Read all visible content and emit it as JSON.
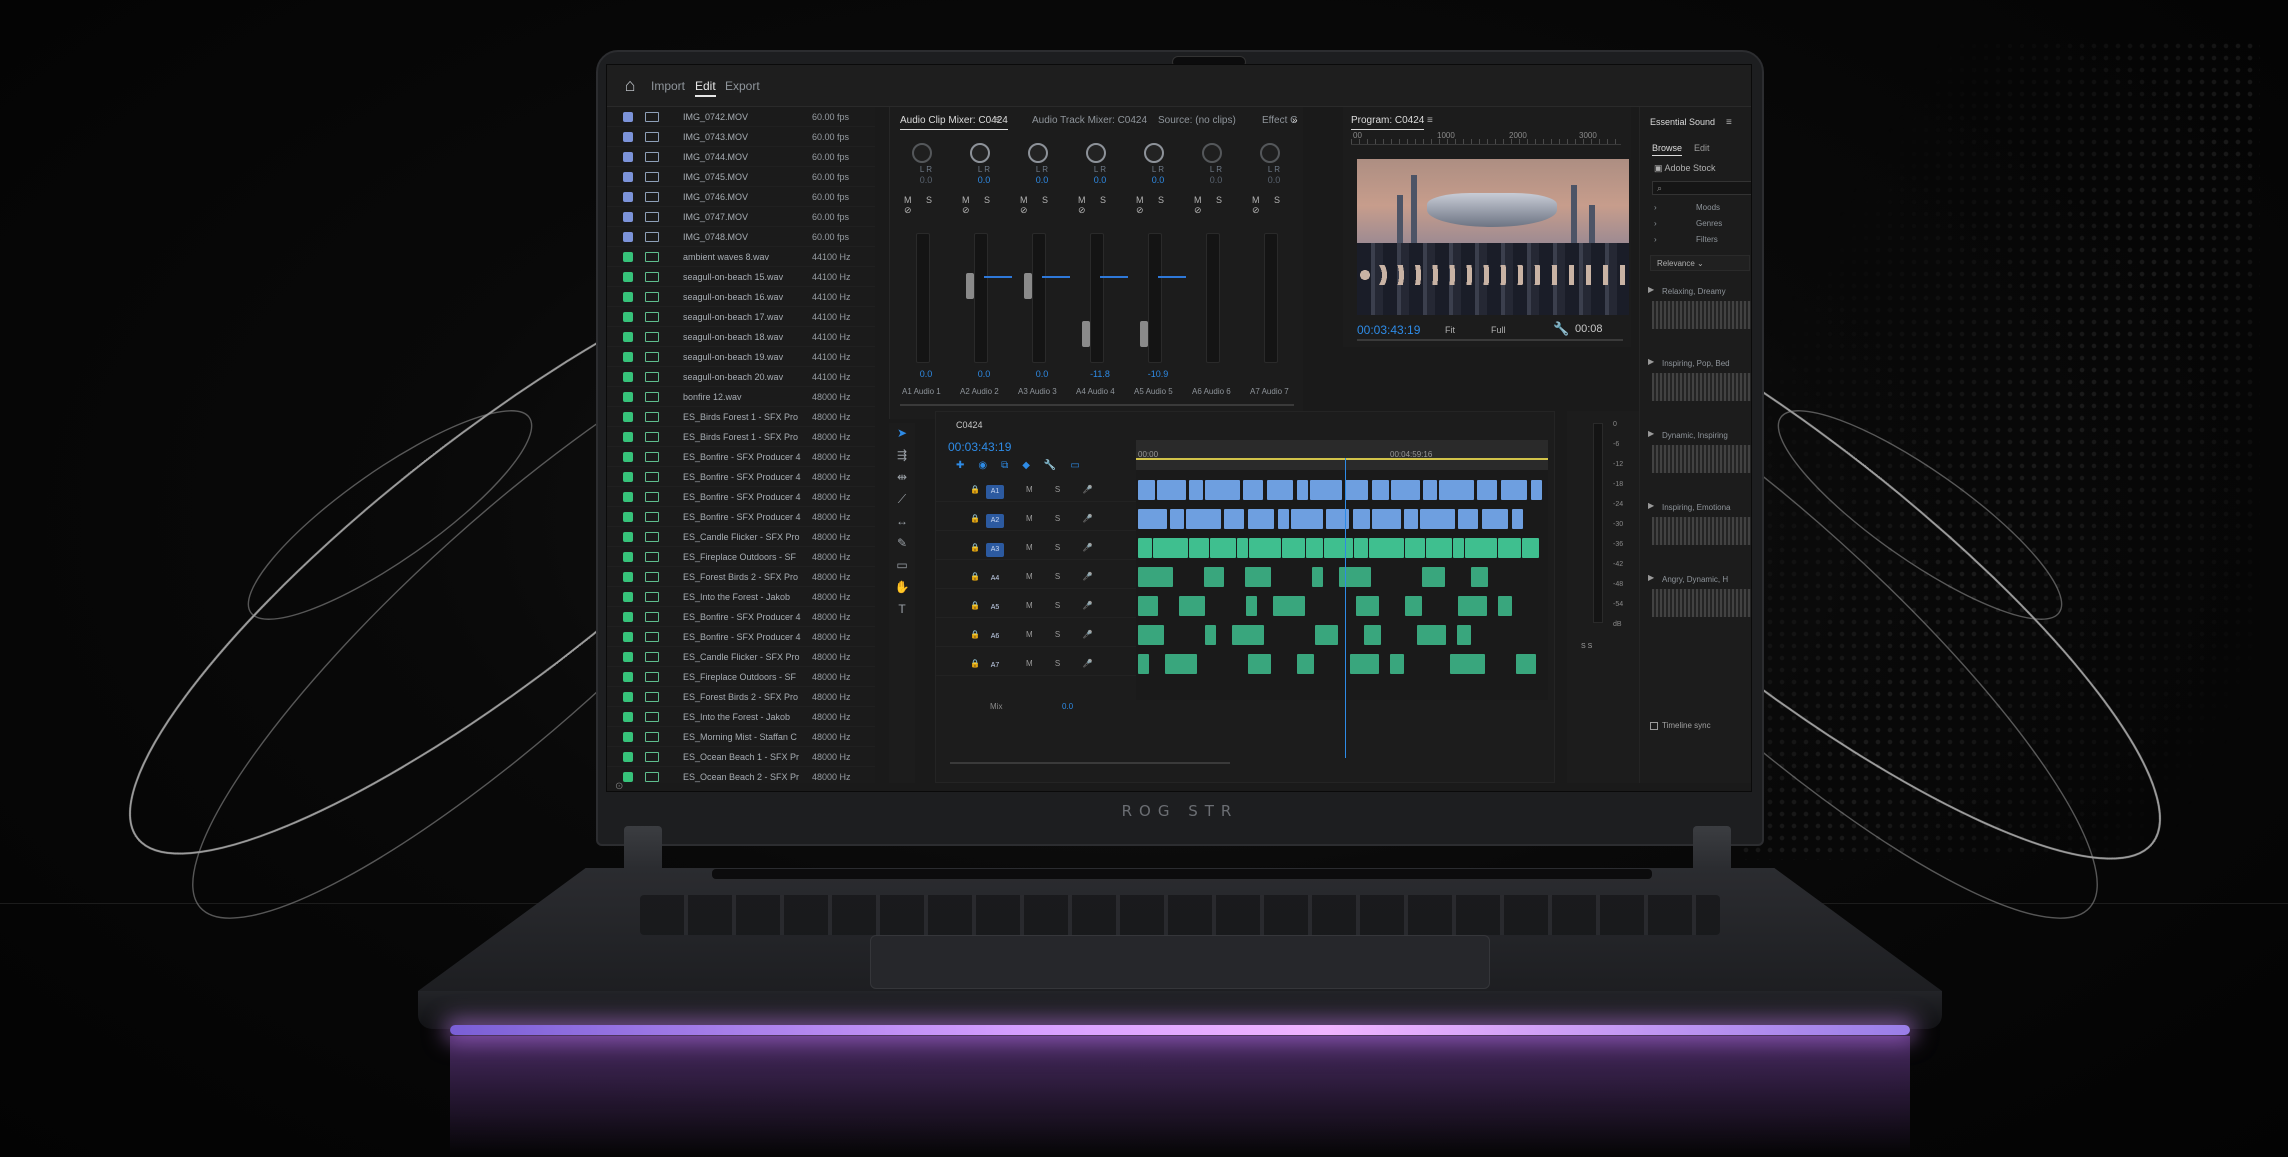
{
  "brand": {
    "text": "ROG STR"
  },
  "topbar": {
    "import": "Import",
    "edit": "Edit",
    "export": "Export"
  },
  "project_items": [
    {
      "name": "IMG_0742.MOV",
      "rate": "60.00 fps",
      "kind": "video"
    },
    {
      "name": "IMG_0743.MOV",
      "rate": "60.00 fps",
      "kind": "video"
    },
    {
      "name": "IMG_0744.MOV",
      "rate": "60.00 fps",
      "kind": "video"
    },
    {
      "name": "IMG_0745.MOV",
      "rate": "60.00 fps",
      "kind": "video"
    },
    {
      "name": "IMG_0746.MOV",
      "rate": "60.00 fps",
      "kind": "video"
    },
    {
      "name": "IMG_0747.MOV",
      "rate": "60.00 fps",
      "kind": "video"
    },
    {
      "name": "IMG_0748.MOV",
      "rate": "60.00 fps",
      "kind": "video"
    },
    {
      "name": "ambient waves 8.wav",
      "rate": "44100 Hz",
      "kind": "audio"
    },
    {
      "name": "seagull-on-beach 15.wav",
      "rate": "44100 Hz",
      "kind": "audio"
    },
    {
      "name": "seagull-on-beach 16.wav",
      "rate": "44100 Hz",
      "kind": "audio"
    },
    {
      "name": "seagull-on-beach 17.wav",
      "rate": "44100 Hz",
      "kind": "audio"
    },
    {
      "name": "seagull-on-beach 18.wav",
      "rate": "44100 Hz",
      "kind": "audio"
    },
    {
      "name": "seagull-on-beach 19.wav",
      "rate": "44100 Hz",
      "kind": "audio"
    },
    {
      "name": "seagull-on-beach 20.wav",
      "rate": "44100 Hz",
      "kind": "audio"
    },
    {
      "name": "bonfire 12.wav",
      "rate": "48000 Hz",
      "kind": "audio"
    },
    {
      "name": "ES_Birds Forest 1 - SFX Pro",
      "rate": "48000 Hz",
      "kind": "audio"
    },
    {
      "name": "ES_Birds Forest 1 - SFX Pro",
      "rate": "48000 Hz",
      "kind": "audio"
    },
    {
      "name": "ES_Bonfire - SFX Producer 4",
      "rate": "48000 Hz",
      "kind": "audio"
    },
    {
      "name": "ES_Bonfire - SFX Producer 4",
      "rate": "48000 Hz",
      "kind": "audio"
    },
    {
      "name": "ES_Bonfire - SFX Producer 4",
      "rate": "48000 Hz",
      "kind": "audio"
    },
    {
      "name": "ES_Bonfire - SFX Producer 4",
      "rate": "48000 Hz",
      "kind": "audio"
    },
    {
      "name": "ES_Candle Flicker - SFX Pro",
      "rate": "48000 Hz",
      "kind": "audio"
    },
    {
      "name": "ES_Fireplace Outdoors - SF",
      "rate": "48000 Hz",
      "kind": "audio"
    },
    {
      "name": "ES_Forest Birds 2 - SFX Pro",
      "rate": "48000 Hz",
      "kind": "audio"
    },
    {
      "name": "ES_Into the Forest - Jakob",
      "rate": "48000 Hz",
      "kind": "audio"
    },
    {
      "name": "ES_Bonfire - SFX Producer 4",
      "rate": "48000 Hz",
      "kind": "audio"
    },
    {
      "name": "ES_Bonfire - SFX Producer 4",
      "rate": "48000 Hz",
      "kind": "audio"
    },
    {
      "name": "ES_Candle Flicker - SFX Pro",
      "rate": "48000 Hz",
      "kind": "audio"
    },
    {
      "name": "ES_Fireplace Outdoors - SF",
      "rate": "48000 Hz",
      "kind": "audio"
    },
    {
      "name": "ES_Forest Birds 2 - SFX Pro",
      "rate": "48000 Hz",
      "kind": "audio"
    },
    {
      "name": "ES_Into the Forest - Jakob",
      "rate": "48000 Hz",
      "kind": "audio"
    },
    {
      "name": "ES_Morning Mist - Staffan C",
      "rate": "48000 Hz",
      "kind": "audio"
    },
    {
      "name": "ES_Ocean Beach 1 - SFX Pr",
      "rate": "48000 Hz",
      "kind": "audio"
    },
    {
      "name": "ES_Ocean Beach 2 - SFX Pr",
      "rate": "48000 Hz",
      "kind": "audio"
    }
  ],
  "mixer": {
    "tabs": [
      "Audio Clip Mixer: C0424",
      "Audio Track Mixer: C0424",
      "Source: (no clips)",
      "Effect C"
    ],
    "strip_lr": "L R",
    "strip_ms": "M S ⊘",
    "channels": [
      {
        "knob": "0.0",
        "fader": "0.0",
        "label": "A1",
        "name": "Audio 1",
        "active": false
      },
      {
        "knob": "0.0",
        "fader": "0.0",
        "label": "A2",
        "name": "Audio 2",
        "active": true
      },
      {
        "knob": "0.0",
        "fader": "0.0",
        "label": "A3",
        "name": "Audio 3",
        "active": true
      },
      {
        "knob": "0.0",
        "fader": "-11.8",
        "label": "A4",
        "name": "Audio 4",
        "active": true
      },
      {
        "knob": "0.0",
        "fader": "-10.9",
        "label": "A5",
        "name": "Audio 5",
        "active": true
      },
      {
        "knob": "0.0",
        "fader": "",
        "label": "A6",
        "name": "Audio 6",
        "active": false
      },
      {
        "knob": "0.0",
        "fader": "",
        "label": "A7",
        "name": "Audio 7",
        "active": false
      }
    ]
  },
  "program": {
    "title": "Program: C0424",
    "ruler": [
      "00",
      "1000",
      "2000",
      "3000"
    ],
    "timecode": "00:03:43:19",
    "fit": "Fit",
    "full": "Full",
    "duration": "00:08"
  },
  "timeline": {
    "tab": "C0424",
    "timecode": "00:03:43:19",
    "ruler": [
      "00:00",
      "00:04:59:16"
    ],
    "tracks": [
      {
        "name": "A1",
        "selected": true
      },
      {
        "name": "A2",
        "selected": true
      },
      {
        "name": "A3",
        "selected": true
      },
      {
        "name": "A4",
        "selected": false
      },
      {
        "name": "A5",
        "selected": false
      },
      {
        "name": "A6",
        "selected": false
      },
      {
        "name": "A7",
        "selected": false
      }
    ],
    "track_ms": "M S 🎤",
    "mix_label": "Mix",
    "mix_value": "0.0",
    "meter_scale": [
      "0",
      "-6",
      "-12",
      "-18",
      "-24",
      "-30",
      "-36",
      "-42",
      "-48",
      "-54",
      "dB"
    ],
    "meter_solo": "S S"
  },
  "essential_sound": {
    "title": "Essential Sound",
    "tabs": [
      "Browse",
      "Edit"
    ],
    "stock": "Adobe Stock",
    "filters": [
      "Moods",
      "Genres",
      "Filters"
    ],
    "sort": "Relevance",
    "results": [
      "Relaxing, Dreamy",
      "Inspiring, Pop, Bed",
      "Dynamic, Inspiring",
      "Inspiring, Emotiona",
      "Angry, Dynamic, H"
    ],
    "sync": "Timeline sync"
  },
  "colors": {
    "accent": "#2e8be6",
    "video_label": "#7c93d9",
    "audio_label": "#37c27a",
    "clip_blue": "#6e9fe0",
    "clip_green": "#3fbf8f"
  }
}
